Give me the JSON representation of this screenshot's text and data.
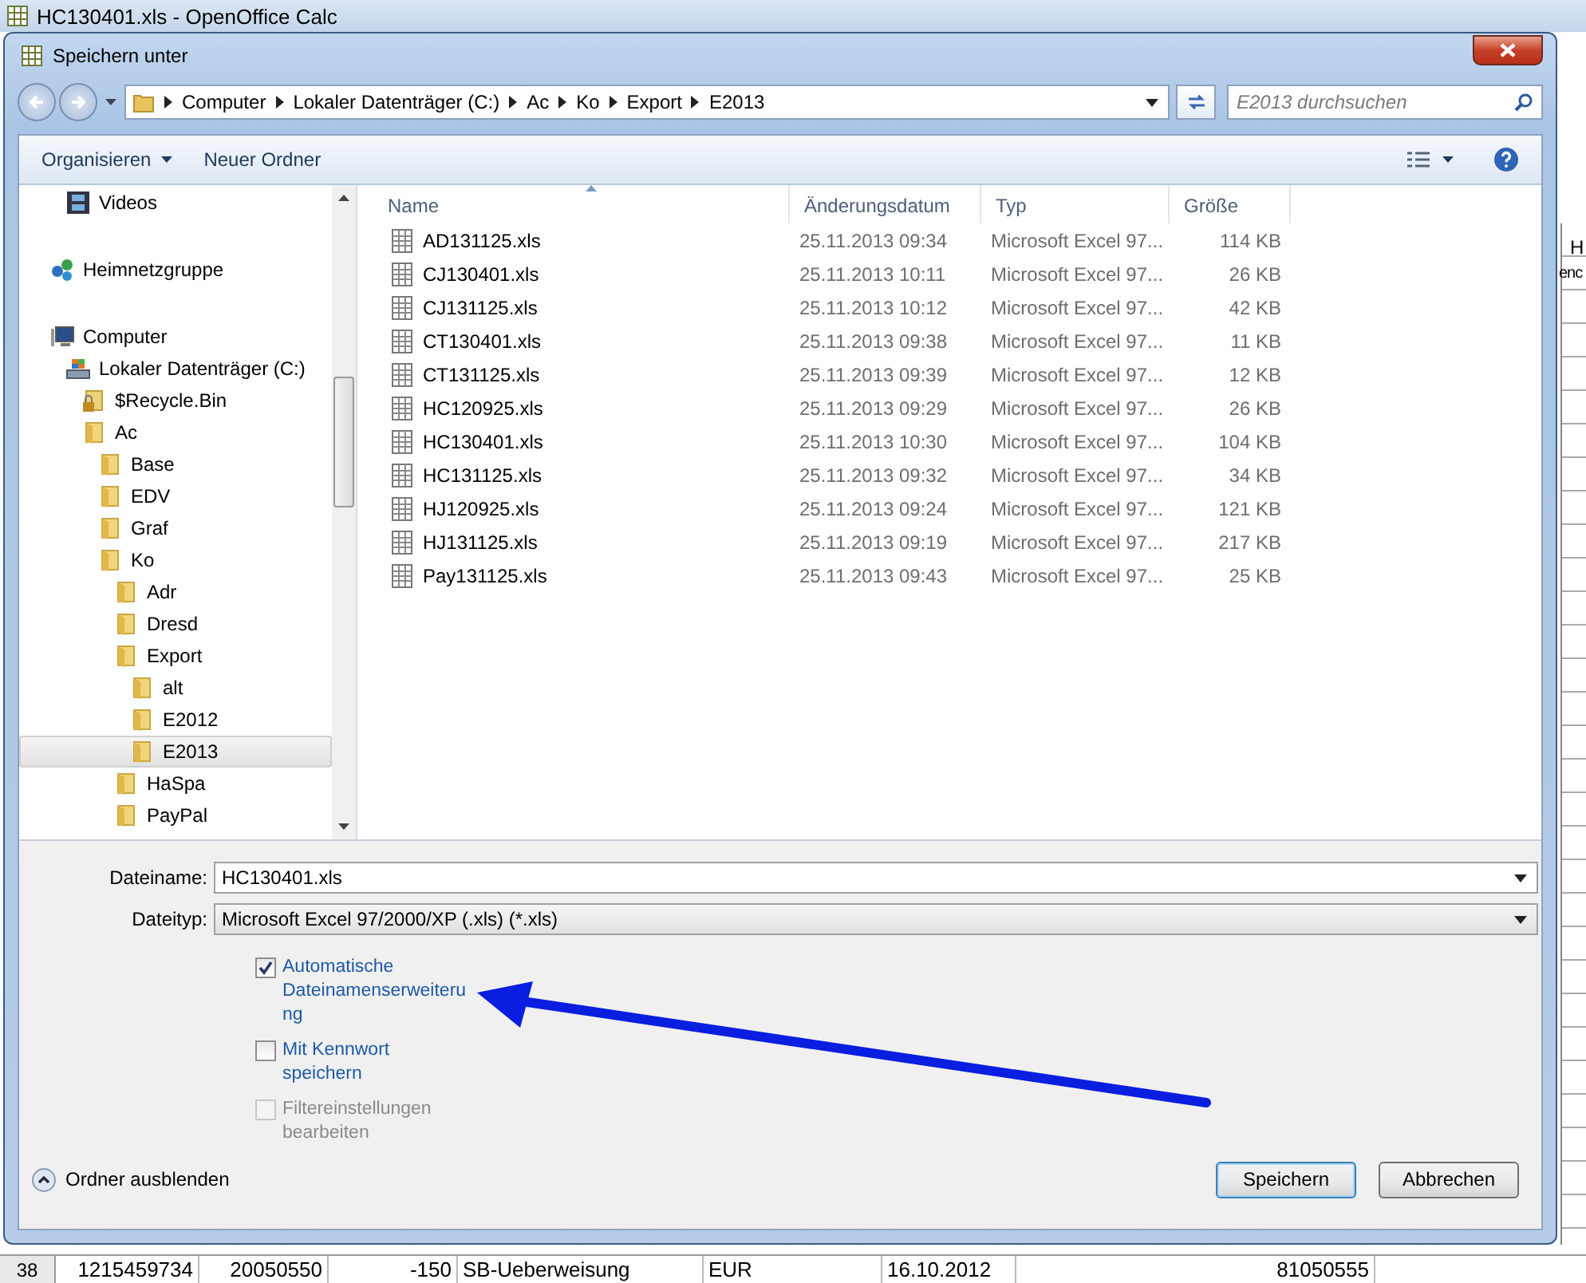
{
  "app_window": {
    "title": "HC130401.xls - OpenOffice Calc"
  },
  "sheet": {
    "edge_texts": [
      "H",
      "enc"
    ],
    "visible_row": {
      "number": "38",
      "cells": [
        "1215459734",
        "20050550",
        "-150",
        "SB-Ueberweisung",
        "EUR",
        "16.10.2012",
        "81050555"
      ]
    }
  },
  "dialog": {
    "title": "Speichern unter",
    "breadcrumb": [
      "Computer",
      "Lokaler Datenträger (C:)",
      "Ac",
      "Ko",
      "Export",
      "E2013"
    ],
    "search": {
      "placeholder": "E2013 durchsuchen"
    },
    "toolbar": [
      {
        "label": "Organisieren",
        "dropdown": true
      },
      {
        "label": "Neuer Ordner",
        "dropdown": false
      }
    ],
    "tree": [
      {
        "label": "Videos",
        "kind": "library",
        "selected": false
      },
      {
        "label": "Heimnetzgruppe",
        "kind": "homegroup",
        "selected": false
      },
      {
        "label": "Computer",
        "kind": "computer",
        "selected": false,
        "children": [
          {
            "label": "Lokaler Datenträger (C:)",
            "kind": "drive",
            "selected": false,
            "children": [
              {
                "label": "$Recycle.Bin",
                "kind": "locked-folder",
                "selected": false
              },
              {
                "label": "Ac",
                "kind": "folder",
                "selected": false,
                "children": [
                  {
                    "label": "Base",
                    "kind": "folder",
                    "selected": false
                  },
                  {
                    "label": "EDV",
                    "kind": "folder",
                    "selected": false
                  },
                  {
                    "label": "Graf",
                    "kind": "folder",
                    "selected": false
                  },
                  {
                    "label": "Ko",
                    "kind": "folder",
                    "selected": false,
                    "children": [
                      {
                        "label": "Adr",
                        "kind": "folder",
                        "selected": false
                      },
                      {
                        "label": "Dresd",
                        "kind": "folder",
                        "selected": false
                      },
                      {
                        "label": "Export",
                        "kind": "folder",
                        "selected": false,
                        "children": [
                          {
                            "label": "alt",
                            "kind": "folder",
                            "selected": false
                          },
                          {
                            "label": "E2012",
                            "kind": "folder",
                            "selected": false
                          },
                          {
                            "label": "E2013",
                            "kind": "folder",
                            "selected": true
                          }
                        ]
                      },
                      {
                        "label": "HaSpa",
                        "kind": "folder",
                        "selected": false
                      },
                      {
                        "label": "PayPal",
                        "kind": "folder",
                        "selected": false
                      }
                    ]
                  }
                ]
              }
            ]
          }
        ]
      }
    ],
    "file_list": {
      "columns": [
        "Name",
        "Änderungsdatum",
        "Typ",
        "Größe"
      ],
      "rows": [
        {
          "name": "AD131125.xls",
          "date": "25.11.2013 09:34",
          "type": "Microsoft Excel 97...",
          "size": "114 KB"
        },
        {
          "name": "CJ130401.xls",
          "date": "25.11.2013 10:11",
          "type": "Microsoft Excel 97...",
          "size": "26 KB"
        },
        {
          "name": "CJ131125.xls",
          "date": "25.11.2013 10:12",
          "type": "Microsoft Excel 97...",
          "size": "42 KB"
        },
        {
          "name": "CT130401.xls",
          "date": "25.11.2013 09:38",
          "type": "Microsoft Excel 97...",
          "size": "11 KB"
        },
        {
          "name": "CT131125.xls",
          "date": "25.11.2013 09:39",
          "type": "Microsoft Excel 97...",
          "size": "12 KB"
        },
        {
          "name": "HC120925.xls",
          "date": "25.11.2013 09:29",
          "type": "Microsoft Excel 97...",
          "size": "26 KB"
        },
        {
          "name": "HC130401.xls",
          "date": "25.11.2013 10:30",
          "type": "Microsoft Excel 97...",
          "size": "104 KB"
        },
        {
          "name": "HC131125.xls",
          "date": "25.11.2013 09:32",
          "type": "Microsoft Excel 97...",
          "size": "34 KB"
        },
        {
          "name": "HJ120925.xls",
          "date": "25.11.2013 09:24",
          "type": "Microsoft Excel 97...",
          "size": "121 KB"
        },
        {
          "name": "HJ131125.xls",
          "date": "25.11.2013 09:19",
          "type": "Microsoft Excel 97...",
          "size": "217 KB"
        },
        {
          "name": "Pay131125.xls",
          "date": "25.11.2013 09:43",
          "type": "Microsoft Excel 97...",
          "size": "25 KB"
        }
      ]
    },
    "filename": {
      "label": "Dateiname:",
      "value": "HC130401.xls"
    },
    "filetype": {
      "label": "Dateityp:",
      "value": "Microsoft Excel 97/2000/XP (.xls) (*.xls)"
    },
    "options": [
      {
        "label": "Automatische\nDateinamenserweiteru\nng",
        "checked": true,
        "disabled": false
      },
      {
        "label": "Mit Kennwort\nspeichern",
        "checked": false,
        "disabled": false
      },
      {
        "label": "Filtereinstellungen\nbearbeiten",
        "checked": false,
        "disabled": true
      }
    ],
    "hide_folders": "Ordner ausblenden",
    "buttons": [
      {
        "label": "Speichern",
        "default": true
      },
      {
        "label": "Abbrechen",
        "default": false
      }
    ]
  }
}
